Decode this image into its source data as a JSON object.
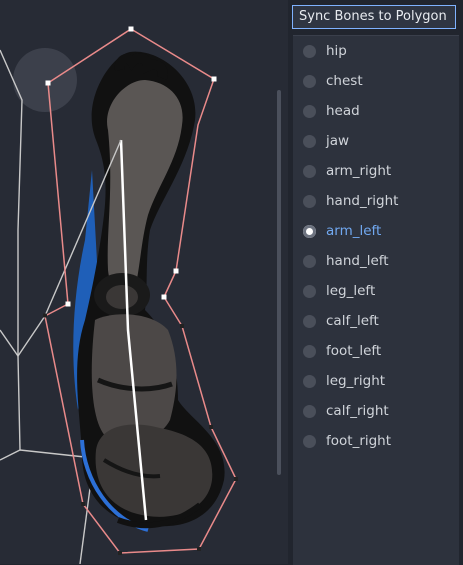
{
  "panel": {
    "sync_button": "Sync Bones to Polygon",
    "bones": [
      {
        "label": "hip",
        "selected": false
      },
      {
        "label": "chest",
        "selected": false
      },
      {
        "label": "head",
        "selected": false
      },
      {
        "label": "jaw",
        "selected": false
      },
      {
        "label": "arm_right",
        "selected": false
      },
      {
        "label": "hand_right",
        "selected": false
      },
      {
        "label": "arm_left",
        "selected": true
      },
      {
        "label": "hand_left",
        "selected": false
      },
      {
        "label": "leg_left",
        "selected": false
      },
      {
        "label": "calf_left",
        "selected": false
      },
      {
        "label": "foot_left",
        "selected": false
      },
      {
        "label": "leg_right",
        "selected": false
      },
      {
        "label": "calf_right",
        "selected": false
      },
      {
        "label": "foot_right",
        "selected": false
      }
    ]
  },
  "colors": {
    "selected_text": "#71a8f0",
    "polygon_outline": "#e98a8a",
    "focus_border": "#7fb2ff"
  }
}
